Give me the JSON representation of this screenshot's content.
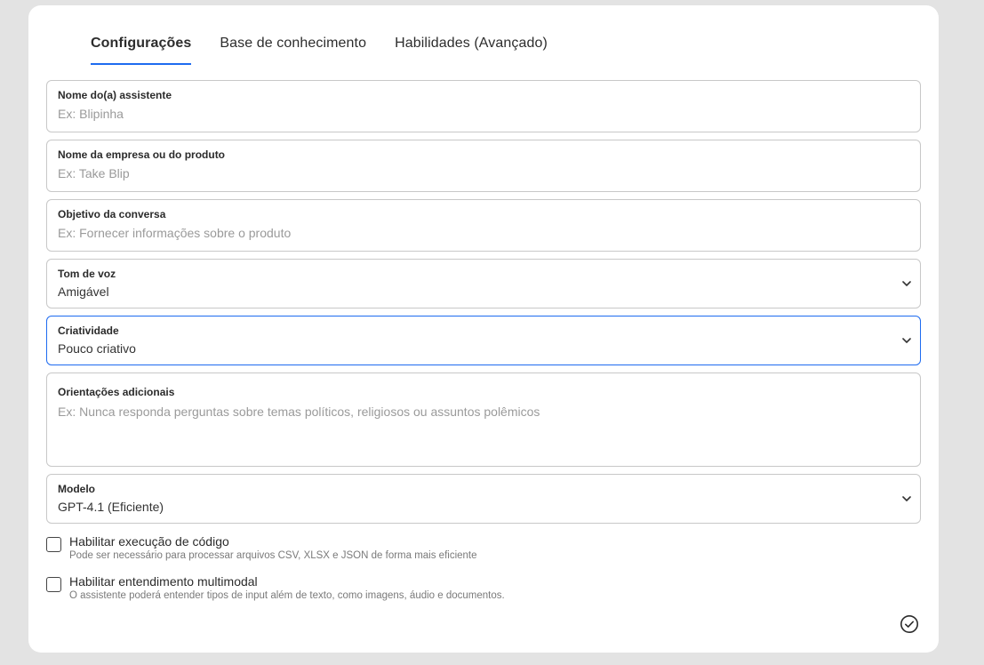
{
  "tabs": [
    {
      "label": "Configurações",
      "active": true
    },
    {
      "label": "Base de conhecimento",
      "active": false
    },
    {
      "label": "Habilidades (Avançado)",
      "active": false
    }
  ],
  "fields": {
    "assistant_name": {
      "label": "Nome do(a) assistente",
      "placeholder": "Ex: Blipinha",
      "value": ""
    },
    "company_name": {
      "label": "Nome da empresa ou do produto",
      "placeholder": "Ex: Take Blip",
      "value": ""
    },
    "objective": {
      "label": "Objetivo da conversa",
      "placeholder": "Ex: Fornecer informações sobre o produto",
      "value": ""
    },
    "tone": {
      "label": "Tom de voz",
      "value": "Amigável"
    },
    "creativity": {
      "label": "Criatividade",
      "value": "Pouco criativo"
    },
    "guidelines": {
      "label": "Orientações adicionais",
      "placeholder": "Ex: Nunca responda perguntas sobre temas políticos, religiosos ou assuntos polêmicos",
      "value": ""
    },
    "model": {
      "label": "Modelo",
      "value": "GPT-4.1 (Eficiente)"
    }
  },
  "checkboxes": {
    "code_execution": {
      "title": "Habilitar execução de código",
      "description": "Pode ser necessário para processar arquivos CSV, XLSX e JSON de forma mais eficiente",
      "checked": false
    },
    "multimodal": {
      "title": "Habilitar entendimento multimodal",
      "description": "O assistente poderá entender tipos de input além de texto, como imagens, áudio e documentos.",
      "checked": false
    }
  },
  "colors": {
    "accent": "#1e6bf0",
    "background": "#e3e3e3",
    "card": "#ffffff"
  },
  "icons": {
    "select": "chevron-down-icon",
    "confirm": "check-circle-icon"
  }
}
